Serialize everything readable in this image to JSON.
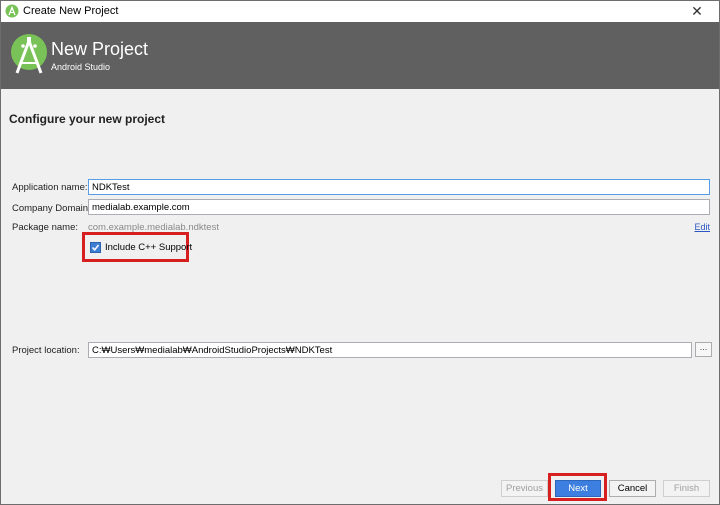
{
  "window": {
    "title": "Create New Project",
    "close_glyph": "✕"
  },
  "banner": {
    "heading": "New Project",
    "subheading": "Android Studio"
  },
  "section_title": "Configure your new project",
  "form": {
    "application_name_label": "Application name:",
    "application_name_value": "NDKTest",
    "company_domain_label": "Company Domain:",
    "company_domain_value": "medialab.example.com",
    "package_name_label": "Package name:",
    "package_name_value": "com.example.medialab.ndktest",
    "edit_link": "Edit",
    "include_cpp_label": "Include C++ Support",
    "include_cpp_checked": true,
    "project_location_label": "Project location:",
    "project_location_value": "C:₩Users₩medialab₩AndroidStudioProjects₩NDKTest",
    "browse_label": "..."
  },
  "buttons": {
    "previous": "Previous",
    "next": "Next",
    "cancel": "Cancel",
    "finish": "Finish"
  },
  "colors": {
    "banner_bg": "#606060",
    "android_green": "#78c257",
    "primary_button": "#3c7fe0",
    "highlight_red": "#d62020"
  }
}
